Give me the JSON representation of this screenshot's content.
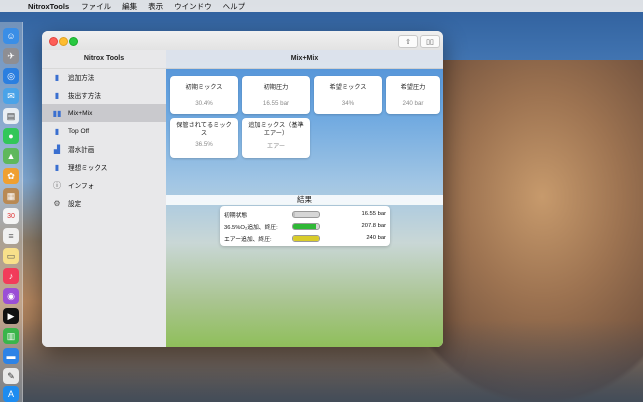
{
  "menubar": {
    "app_name": "NitroxTools",
    "items": [
      "ファイル",
      "編集",
      "表示",
      "ウインドウ",
      "ヘルプ"
    ]
  },
  "window": {
    "title": "Mix+Mix"
  },
  "sidebar": {
    "title": "Nitrox Tools",
    "items": [
      {
        "label": "追加方法",
        "icon": "tank-icon"
      },
      {
        "label": "抜出す方法",
        "icon": "tank-icon"
      },
      {
        "label": "Mix+Mix",
        "icon": "mix-icon",
        "selected": true
      },
      {
        "label": "Top Off",
        "icon": "tank-icon"
      },
      {
        "label": "潜水計画",
        "icon": "chart-icon"
      },
      {
        "label": "理想ミックス",
        "icon": "tank-icon"
      },
      {
        "label": "インフォ",
        "icon": "info-icon"
      },
      {
        "label": "設定",
        "icon": "gear-icon"
      }
    ]
  },
  "cards": [
    {
      "label": "初期ミックス",
      "value": "30.4%"
    },
    {
      "label": "初期圧力",
      "value": "16.55 bar"
    },
    {
      "label": "希望ミックス",
      "value": "34%"
    },
    {
      "label": "希望圧力",
      "value": "240 bar"
    },
    {
      "label": "保管されてるミックス",
      "value": "36.5%"
    },
    {
      "label": "追加ミックス（基準エアー）",
      "value": "エアー"
    }
  ],
  "results": {
    "title": "結果",
    "rows": [
      {
        "label": "初期状態",
        "value": "16.55 bar",
        "fill": 0.07,
        "color": "#c0c0c0"
      },
      {
        "label": "36.5%O₂追加、終圧:",
        "value": "207.8 bar",
        "fill": 0.87,
        "color": "#2fb836"
      },
      {
        "label": "エアー追加、終圧:",
        "value": "240 bar",
        "fill": 1.0,
        "color": "#d9cc2a"
      }
    ]
  }
}
